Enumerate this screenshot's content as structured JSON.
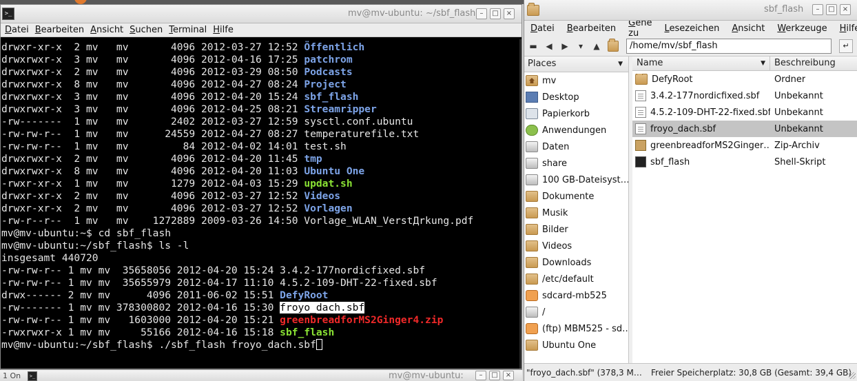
{
  "terminal": {
    "title": "mv@mv-ubuntu: ~/sbf_flash",
    "menu": [
      "Datei",
      "Bearbeiten",
      "Ansicht",
      "Suchen",
      "Terminal",
      "Hilfe"
    ],
    "lines": [
      [
        {
          "t": "drwxr-xr-x  2 mv   mv       4096 2012-03-27 12:52 "
        },
        {
          "t": "Öffentlich",
          "c": "blue"
        }
      ],
      [
        {
          "t": "drwxrwxr-x  3 mv   mv       4096 2012-04-16 17:25 "
        },
        {
          "t": "patchrom",
          "c": "blue"
        }
      ],
      [
        {
          "t": "drwxrwxr-x  2 mv   mv       4096 2012-03-29 08:50 "
        },
        {
          "t": "Podcasts",
          "c": "blue"
        }
      ],
      [
        {
          "t": "drwxrwxr-x  8 mv   mv       4096 2012-04-27 08:24 "
        },
        {
          "t": "Project",
          "c": "blue"
        }
      ],
      [
        {
          "t": "drwxrwxr-x  3 mv   mv       4096 2012-04-20 15:24 "
        },
        {
          "t": "sbf_flash",
          "c": "blue"
        }
      ],
      [
        {
          "t": "drwxrwxr-x  3 mv   mv       4096 2012-04-25 08:21 "
        },
        {
          "t": "Streamripper",
          "c": "blue"
        }
      ],
      [
        {
          "t": "-rw-------  1 mv   mv       2402 2012-03-27 12:59 sysctl.conf.ubuntu"
        }
      ],
      [
        {
          "t": "-rw-rw-r--  1 mv   mv      24559 2012-04-27 08:27 temperaturefile.txt"
        }
      ],
      [
        {
          "t": "-rw-rw-r--  1 mv   mv         84 2012-04-02 14:01 test.sh"
        }
      ],
      [
        {
          "t": "drwxrwxr-x  2 mv   mv       4096 2012-04-20 11:45 "
        },
        {
          "t": "tmp",
          "c": "blue"
        }
      ],
      [
        {
          "t": "drwxrwxr-x  8 mv   mv       4096 2012-04-20 11:03 "
        },
        {
          "t": "Ubuntu One",
          "c": "blue"
        }
      ],
      [
        {
          "t": "-rwxr-xr-x  1 mv   mv       1279 2012-04-03 15:29 "
        },
        {
          "t": "updat.sh",
          "c": "green"
        }
      ],
      [
        {
          "t": "drwxr-xr-x  2 mv   mv       4096 2012-03-27 12:52 "
        },
        {
          "t": "Videos",
          "c": "blue"
        }
      ],
      [
        {
          "t": "drwxr-xr-x  2 mv   mv       4096 2012-03-27 12:52 "
        },
        {
          "t": "Vorlagen",
          "c": "blue"
        }
      ],
      [
        {
          "t": "-rw-r--r--  1 mv   mv    1272889 2009-03-26 14:50 Vorlage_WLAN_VerstДrkung.pdf"
        }
      ],
      [
        {
          "t": "mv@mv-ubuntu:~$ cd sbf_flash"
        }
      ],
      [
        {
          "t": "mv@mv-ubuntu:~/sbf_flash$ ls -l"
        }
      ],
      [
        {
          "t": "insgesamt 440720"
        }
      ],
      [
        {
          "t": "-rw-rw-r-- 1 mv mv  35658056 2012-04-20 15:24 3.4.2-177nordicfixed.sbf"
        }
      ],
      [
        {
          "t": "-rw-rw-r-- 1 mv mv  35655979 2012-04-17 11:10 4.5.2-109-DHT-22-fixed.sbf"
        }
      ],
      [
        {
          "t": "drwx------ 2 mv mv      4096 2011-06-02 15:51 "
        },
        {
          "t": "DefyRoot",
          "c": "blue"
        }
      ],
      [
        {
          "t": "-rw------- 1 mv mv 378300802 2012-04-16 15:30 "
        },
        {
          "t": "froyo_dach.sbf",
          "c": "sel"
        }
      ],
      [
        {
          "t": "-rw-rw-r-- 1 mv mv   1603000 2012-04-20 15:21 "
        },
        {
          "t": "greenbreadforMS2Ginger4.zip",
          "c": "red"
        }
      ],
      [
        {
          "t": "-rwxrwxr-x 1 mv mv     55166 2012-04-16 15:18 "
        },
        {
          "t": "sbf_flash",
          "c": "green"
        }
      ],
      [
        {
          "t": "mv@mv-ubuntu:~/sbf_flash$ ./sbf_flash froyo_dach.sbf"
        },
        {
          "t": "",
          "c": "cursor"
        }
      ]
    ]
  },
  "terminal2": {
    "left_text": "1  On",
    "title": "mv@mv-ubuntu:"
  },
  "filemanager": {
    "title": "sbf_flash",
    "menu": [
      "Datei",
      "Bearbeiten",
      "Gehe zu",
      "Lesezeichen",
      "Ansicht",
      "Werkzeuge",
      "Hilfe"
    ],
    "location": "/home/mv/sbf_flash",
    "places_label": "Places",
    "places": [
      {
        "label": "mv",
        "icon": "ico-home"
      },
      {
        "label": "Desktop",
        "icon": "ico-desk"
      },
      {
        "label": "Papierkorb",
        "icon": "ico-trash"
      },
      {
        "label": "Anwendungen",
        "icon": "ico-apps"
      },
      {
        "label": "Daten",
        "icon": "ico-drive"
      },
      {
        "label": "share",
        "icon": "ico-drive"
      },
      {
        "label": "100 GB-Dateisyst…",
        "icon": "ico-drive"
      },
      {
        "label": "Dokumente",
        "icon": "ico-folder"
      },
      {
        "label": "Musik",
        "icon": "ico-folder"
      },
      {
        "label": "Bilder",
        "icon": "ico-folder"
      },
      {
        "label": "Videos",
        "icon": "ico-folder"
      },
      {
        "label": "Downloads",
        "icon": "ico-folder"
      },
      {
        "label": "/etc/default",
        "icon": "ico-folder"
      },
      {
        "label": "sdcard-mb525",
        "icon": "ico-net"
      },
      {
        "label": "/",
        "icon": "ico-drive"
      },
      {
        "label": "(ftp) MBM525 - sd…",
        "icon": "ico-net"
      },
      {
        "label": "Ubuntu One",
        "icon": "ico-folder"
      }
    ],
    "columns": {
      "name": "Name",
      "desc": "Beschreibung"
    },
    "files": [
      {
        "name": "DefyRoot",
        "desc": "Ordner",
        "icon": "folder-icon",
        "selected": false
      },
      {
        "name": "3.4.2-177nordicfixed.sbf",
        "desc": "Unbekannt",
        "icon": "document-icon",
        "selected": false
      },
      {
        "name": "4.5.2-109-DHT-22-fixed.sbf",
        "desc": "Unbekannt",
        "icon": "document-icon",
        "selected": false
      },
      {
        "name": "froyo_dach.sbf",
        "desc": "Unbekannt",
        "icon": "document-icon",
        "selected": true
      },
      {
        "name": "greenbreadforMS2Ginger…",
        "desc": "Zip-Archiv",
        "icon": "archive-icon",
        "selected": false
      },
      {
        "name": "sbf_flash",
        "desc": "Shell-Skript",
        "icon": "script-icon",
        "selected": false
      }
    ],
    "status_left": "\"froyo_dach.sbf\" (378,3 M…",
    "status_right": "Freier Speicherplatz: 30,8 GB (Gesamt: 39,4 GB)"
  }
}
